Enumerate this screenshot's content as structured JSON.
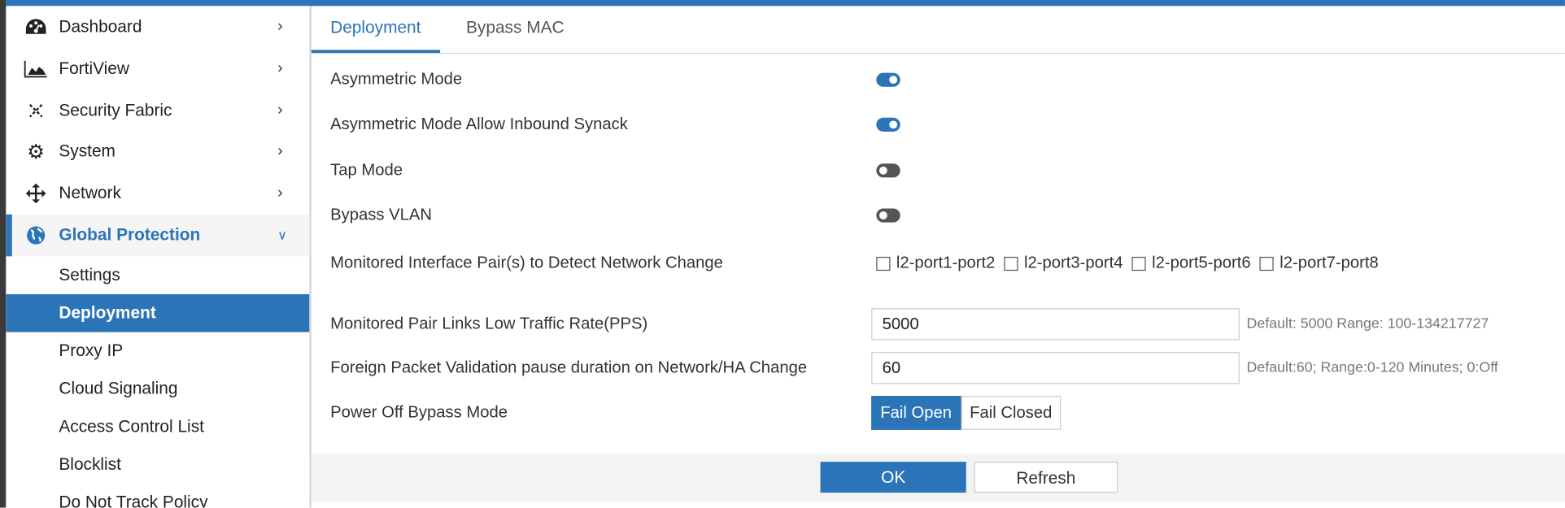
{
  "sidebar": {
    "items": [
      {
        "label": "Dashboard",
        "icon": "dashboard-icon"
      },
      {
        "label": "FortiView",
        "icon": "area-chart-icon"
      },
      {
        "label": "Security Fabric",
        "icon": "security-fabric-icon"
      },
      {
        "label": "System",
        "icon": "gear-icon"
      },
      {
        "label": "Network",
        "icon": "move-arrows-icon"
      },
      {
        "label": "Global Protection",
        "icon": "globe-icon"
      }
    ],
    "sub_items": [
      "Settings",
      "Deployment",
      "Proxy IP",
      "Cloud Signaling",
      "Access Control List",
      "Blocklist",
      "Do Not Track Policy"
    ],
    "selected": "Deployment"
  },
  "tabs": [
    "Deployment",
    "Bypass MAC"
  ],
  "form": {
    "asymmetric_mode": {
      "label": "Asymmetric Mode",
      "enabled": true
    },
    "asymmetric_synack": {
      "label": "Asymmetric Mode Allow Inbound Synack",
      "enabled": true
    },
    "tap_mode": {
      "label": "Tap Mode",
      "enabled": false
    },
    "bypass_vlan": {
      "label": "Bypass VLAN",
      "enabled": false
    },
    "monitored_pairs": {
      "label": "Monitored Interface Pair(s) to Detect Network Change",
      "options": [
        "l2-port1-port2",
        "l2-port3-port4",
        "l2-port5-port6",
        "l2-port7-port8"
      ]
    },
    "low_traffic_rate": {
      "label": "Monitored Pair Links Low Traffic Rate(PPS)",
      "value": "5000",
      "hint": "Default: 5000 Range: 100-134217727"
    },
    "fpv_pause": {
      "label": "Foreign Packet Validation pause duration on Network/HA Change",
      "value": "60",
      "hint": "Default:60; Range:0-120 Minutes; 0:Off"
    },
    "power_off_bypass": {
      "label": "Power Off Bypass Mode",
      "options": [
        "Fail Open",
        "Fail Closed"
      ],
      "selected": "Fail Open"
    }
  },
  "footer": {
    "ok": "OK",
    "refresh": "Refresh"
  },
  "colors": {
    "accent": "#2c74b8"
  }
}
